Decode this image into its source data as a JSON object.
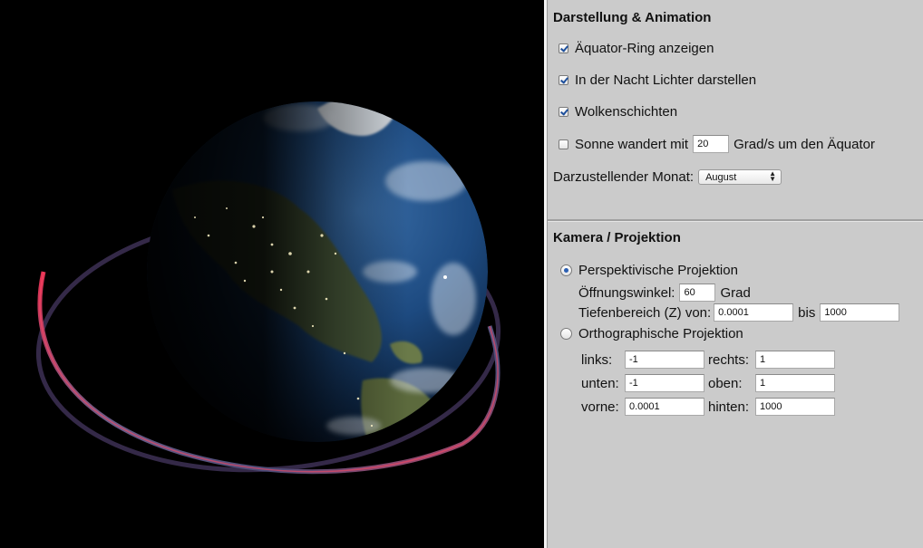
{
  "animation": {
    "title": "Darstellung & Animation",
    "equator_ring": {
      "label": "Äquator-Ring anzeigen",
      "checked": true
    },
    "night_lights": {
      "label": "In der Nacht Lichter darstellen",
      "checked": true
    },
    "clouds": {
      "label": "Wolkenschichten",
      "checked": true
    },
    "sun_moves": {
      "label_prefix": "Sonne wandert mit",
      "value": "20",
      "label_suffix": "Grad/s um den Äquator",
      "checked": false
    },
    "month": {
      "label": "Darzustellender Monat:",
      "value": "August"
    }
  },
  "camera": {
    "title": "Kamera / Projektion",
    "perspective": {
      "label": "Perspektivische Projektion",
      "selected": true,
      "fov_label": "Öffnungswinkel:",
      "fov_value": "60",
      "fov_unit": "Grad",
      "depth_label": "Tiefenbereich (Z) von:",
      "depth_from": "0.0001",
      "depth_to_label": "bis",
      "depth_to": "1000"
    },
    "orthographic": {
      "label": "Orthographische Projektion",
      "selected": false,
      "left_label": "links:",
      "left_value": "-1",
      "right_label": "rechts:",
      "right_value": "1",
      "bottom_label": "unten:",
      "bottom_value": "-1",
      "top_label": "oben:",
      "top_value": "1",
      "near_label": "vorne:",
      "near_value": "0.0001",
      "far_label": "hinten:",
      "far_value": "1000"
    }
  },
  "colors": {
    "panel_bg": "#cbcbcb",
    "ring_glow": "#d8304a",
    "ring_back": "#6a6a9a",
    "ocean": "#1e4d86"
  }
}
